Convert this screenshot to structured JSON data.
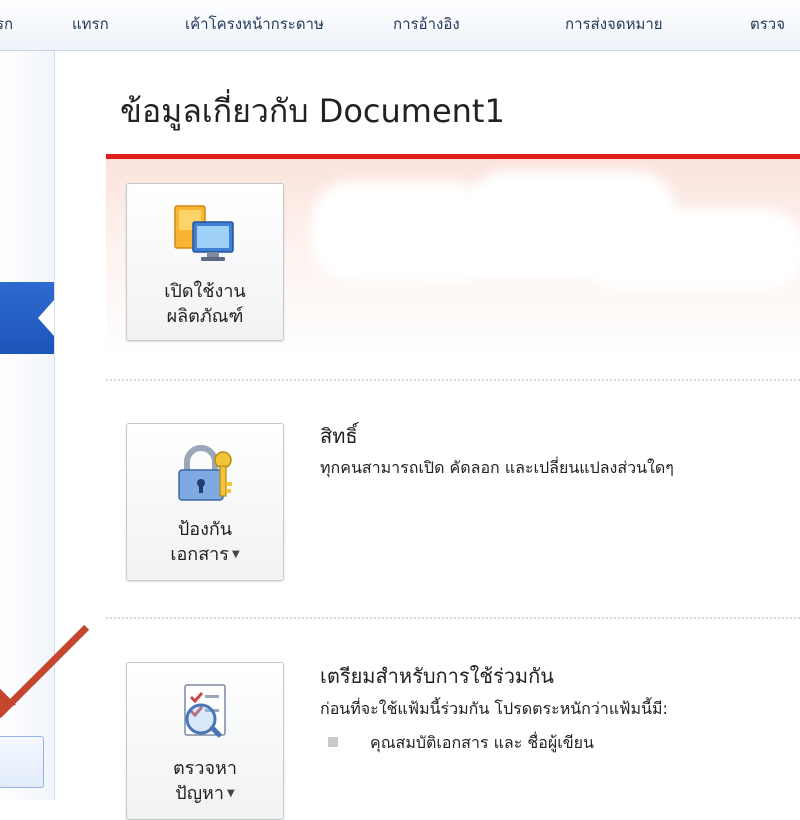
{
  "ribbon_tabs": [
    "รก",
    "แทรก",
    "เค้าโครงหน้ากระดาษ",
    "การอ้างอิง",
    "การส่งจดหมาย",
    "ตรวจ"
  ],
  "page_title": "ข้อมูลเกี่ยวกับ Document1",
  "activate_button": {
    "line1": "เปิดใช้งาน",
    "line2": "ผลิตภัณฑ์"
  },
  "protect_button": {
    "line1": "ป้องกัน",
    "line2": "เอกสาร",
    "icon": "padlock-key-icon"
  },
  "permissions": {
    "heading": "สิทธิ์",
    "description": "ทุกคนสามารถเปิด คัดลอก และเปลี่ยนแปลงส่วนใดๆ"
  },
  "inspect_button": {
    "line1": "ตรวจหา",
    "line2": "ปัญหา",
    "icon": "checklist-magnifier-icon"
  },
  "prepare_sharing": {
    "heading": "เตรียมสำหรับการใช้ร่วมกัน",
    "description": "ก่อนที่จะใช้แฟ้มนี้ร่วมกัน โปรดตระหนักว่าแฟ้มนี้มี:",
    "items": [
      "คุณสมบัติเอกสาร และ ชื่อผู้เขียน"
    ]
  },
  "colors": {
    "accent_red": "#e21c1c",
    "selection_blue": "#1c55b8",
    "arrow": "#c4462e"
  }
}
